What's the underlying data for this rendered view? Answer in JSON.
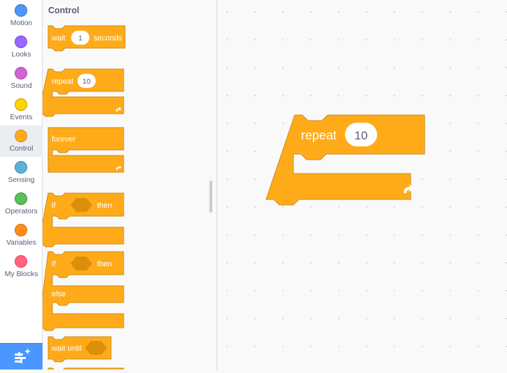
{
  "colors": {
    "control": "#ffab19",
    "control_dark": "#cf8b17",
    "control_hex": "#db8f0a",
    "motion": "#4c97ff",
    "looks": "#9966ff",
    "sound": "#cf63cf",
    "events": "#ffd500",
    "sensing": "#5cb1d6",
    "operators": "#59c059",
    "variables": "#ff8c1a",
    "myblocks": "#ff6680",
    "text_gray": "#575e75",
    "accent": "#4c97ff"
  },
  "categories": [
    {
      "label": "Motion",
      "color": "#4c97ff",
      "border": "#3373cc"
    },
    {
      "label": "Looks",
      "color": "#9966ff",
      "border": "#774dcb"
    },
    {
      "label": "Sound",
      "color": "#cf63cf",
      "border": "#bd42bd"
    },
    {
      "label": "Events",
      "color": "#ffd500",
      "border": "#cc9900"
    },
    {
      "label": "Control",
      "color": "#ffab19",
      "border": "#cf8b17"
    },
    {
      "label": "Sensing",
      "color": "#5cb1d6",
      "border": "#2e8eb8"
    },
    {
      "label": "Operators",
      "color": "#59c059",
      "border": "#389438"
    },
    {
      "label": "Variables",
      "color": "#ff8c1a",
      "border": "#db6e00"
    },
    {
      "label": "My Blocks",
      "color": "#ff6680",
      "border": "#ff3355"
    }
  ],
  "selected_category": "Control",
  "extension_button": {
    "icon": "add-extension-icon"
  },
  "palette": {
    "title": "Control",
    "blocks": {
      "wait": {
        "text": "wait",
        "value": "1",
        "suffix": "seconds"
      },
      "repeat": {
        "text": "repeat",
        "value": "10",
        "icon": "loop-arrow-icon"
      },
      "forever": {
        "text": "forever",
        "icon": "loop-arrow-icon"
      },
      "if_then": {
        "if": "if",
        "then": "then"
      },
      "if_else": {
        "if": "if",
        "then": "then",
        "else": "else"
      },
      "wait_until": {
        "text": "wait until"
      }
    }
  },
  "workspace": {
    "blocks": [
      {
        "type": "repeat",
        "text": "repeat",
        "value": "10",
        "icon": "loop-arrow-icon"
      }
    ]
  }
}
